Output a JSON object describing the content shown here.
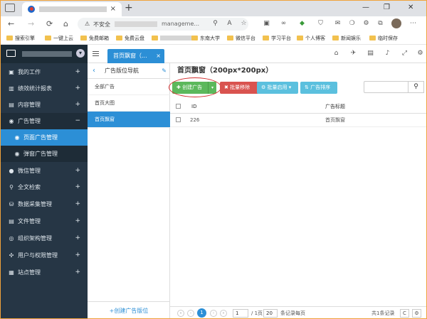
{
  "browser": {
    "page_tab_close": "×",
    "new_tab": "+",
    "window_controls": [
      "—",
      "❐",
      "✕"
    ],
    "nav": [
      "←",
      "→",
      "⟳",
      "⌂"
    ],
    "warn_icon": "⚠",
    "insecure_label": "不安全",
    "url_path": "manageme...",
    "toolbar_icons": [
      "⚲",
      "A",
      "☆",
      "▣",
      "∞",
      "◆",
      "⛉",
      "✉",
      "❍",
      "⚙",
      "⧉",
      "⋯"
    ],
    "bookmarks": [
      "搜索引擎",
      "一键上云",
      "免费邮箱",
      "免费云盘",
      "",
      "东南大学",
      "微信平台",
      "学习平台",
      "个人博客",
      "新闻娱乐",
      "临时保存"
    ]
  },
  "header": {
    "active_tab": "首页飘窗（...",
    "active_tab_close": "×",
    "icons": [
      "⌂",
      "✈",
      "▤",
      "♪",
      "⤢",
      "⚙"
    ]
  },
  "sidebar": {
    "items": [
      {
        "icon": "▣",
        "label": "我的工作",
        "mark": "+"
      },
      {
        "icon": "▥",
        "label": "绩效统计报表",
        "mark": "+"
      },
      {
        "icon": "▤",
        "label": "内容管理",
        "mark": "+"
      },
      {
        "icon": "◉",
        "label": "广告管理",
        "mark": "−"
      },
      {
        "icon": "◉",
        "label": "页面广告管理",
        "mark": ""
      },
      {
        "icon": "◉",
        "label": "弹窗广告管理",
        "mark": ""
      },
      {
        "icon": "●",
        "label": "微信管理",
        "mark": "+"
      },
      {
        "icon": "⚲",
        "label": "全文检索",
        "mark": "+"
      },
      {
        "icon": "⛁",
        "label": "数据采集管理",
        "mark": "+"
      },
      {
        "icon": "▤",
        "label": "文件管理",
        "mark": "+"
      },
      {
        "icon": "◎",
        "label": "组织架构管理",
        "mark": "+"
      },
      {
        "icon": "✣",
        "label": "用户与权限管理",
        "mark": "+"
      },
      {
        "icon": "▦",
        "label": "站点管理",
        "mark": "+"
      }
    ]
  },
  "midpanel": {
    "back": "‹",
    "title": "广告版位导航",
    "pin": "✎",
    "items": [
      "全部广告",
      "首页大图",
      "首页飘窗"
    ],
    "footer": "+创建广告版位"
  },
  "main": {
    "title": "首页飘窗（200px*200px）",
    "buttons": {
      "create": "✚ 创建广告",
      "create_caret": "▾",
      "delete": "✖ 批量移除",
      "enable": "⚙ 批量启用 ▾",
      "sort": "⇅ 广告排序"
    },
    "search": {
      "placeholder": "",
      "icon": "⚲"
    },
    "columns": {
      "id": "ID",
      "title": "广告标题"
    },
    "rows": [
      {
        "id": "226",
        "title": "首页飘窗"
      }
    ],
    "pager": {
      "first": "«",
      "prev": "‹",
      "current": "1",
      "next": "›",
      "last": "»",
      "page_input": "1",
      "page_total": "/ 1页",
      "page_size": "20",
      "per_page_label": "条记录每页",
      "total": "共1条记录",
      "refresh": "C",
      "settings": "⚙"
    }
  }
}
